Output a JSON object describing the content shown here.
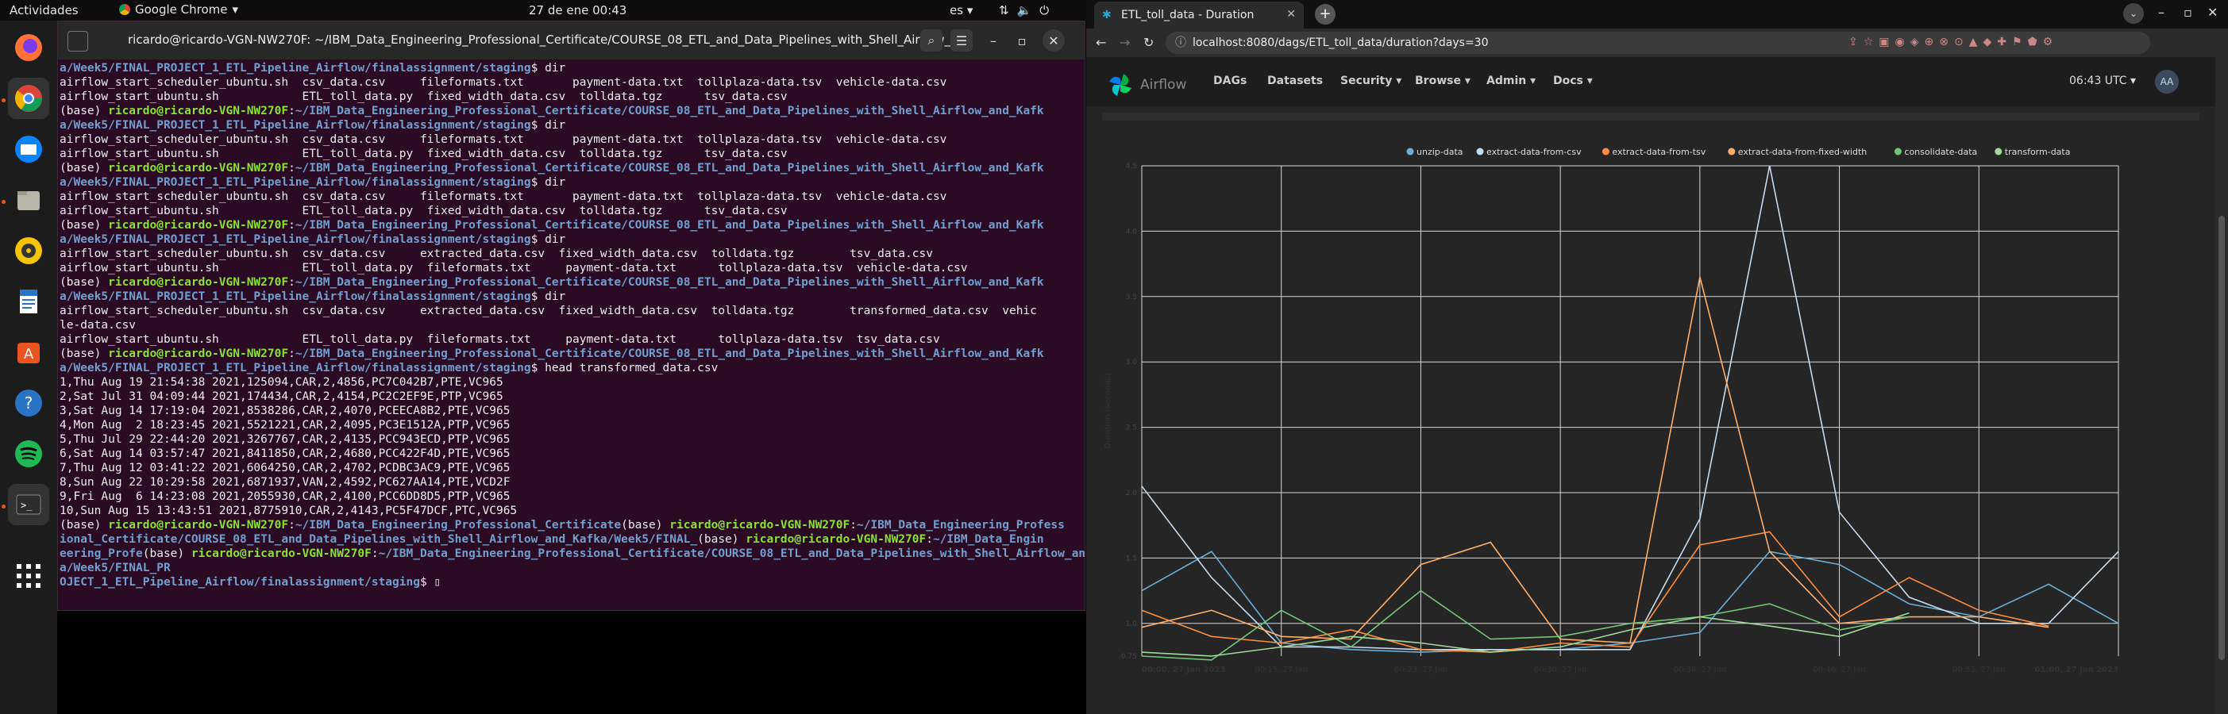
{
  "topbar": {
    "activities": "Actividades",
    "app_name": "Google Chrome",
    "clock": "27 de ene  00:43",
    "lang": "es"
  },
  "terminal": {
    "title": "ricardo@ricardo-VGN-NW270F: ~/IBM_Data_Engineering_Professional_Certificate/COURSE_08_ETL_and_Data_Pipelines_with_Shell_Airflow_...",
    "lines": [
      [
        [
          "t",
          "a/Week5/FINAL_PROJECT_1_ETL_Pipeline_Airflow/finalassignment/staging"
        ],
        [
          "n",
          "$ dir"
        ]
      ],
      [
        [
          "n",
          "airflow_start_scheduler_ubuntu.sh  csv_data.csv     fileformats.txt       payment-data.txt  tollplaza-data.tsv  vehicle-data.csv"
        ]
      ],
      [
        [
          "n",
          "airflow_start_ubuntu.sh            ETL_toll_data.py  fixed_width_data.csv  tolldata.tgz      tsv_data.csv"
        ]
      ],
      [
        [
          "n",
          "(base) "
        ],
        [
          "u",
          "ricardo@ricardo-VGN-NW270F"
        ],
        [
          "n",
          ":"
        ],
        [
          "p",
          "~/IBM_Data_Engineering_Professional_Certificate/COURSE_08_ETL_and_Data_Pipelines_with_Shell_Airflow_and_Kafk"
        ]
      ],
      [
        [
          "p",
          "a/Week5/FINAL_PROJECT_1_ETL_Pipeline_Airflow/finalassignment/staging"
        ],
        [
          "n",
          "$ dir"
        ]
      ],
      [
        [
          "n",
          "airflow_start_scheduler_ubuntu.sh  csv_data.csv     fileformats.txt       payment-data.txt  tollplaza-data.tsv  vehicle-data.csv"
        ]
      ],
      [
        [
          "n",
          "airflow_start_ubuntu.sh            ETL_toll_data.py  fixed_width_data.csv  tolldata.tgz      tsv_data.csv"
        ]
      ],
      [
        [
          "n",
          "(base) "
        ],
        [
          "u",
          "ricardo@ricardo-VGN-NW270F"
        ],
        [
          "n",
          ":"
        ],
        [
          "p",
          "~/IBM_Data_Engineering_Professional_Certificate/COURSE_08_ETL_and_Data_Pipelines_with_Shell_Airflow_and_Kafk"
        ]
      ],
      [
        [
          "p",
          "a/Week5/FINAL_PROJECT_1_ETL_Pipeline_Airflow/finalassignment/staging"
        ],
        [
          "n",
          "$ dir"
        ]
      ],
      [
        [
          "n",
          "airflow_start_scheduler_ubuntu.sh  csv_data.csv     fileformats.txt       payment-data.txt  tollplaza-data.tsv  vehicle-data.csv"
        ]
      ],
      [
        [
          "n",
          "airflow_start_ubuntu.sh            ETL_toll_data.py  fixed_width_data.csv  tolldata.tgz      tsv_data.csv"
        ]
      ],
      [
        [
          "n",
          "(base) "
        ],
        [
          "u",
          "ricardo@ricardo-VGN-NW270F"
        ],
        [
          "n",
          ":"
        ],
        [
          "p",
          "~/IBM_Data_Engineering_Professional_Certificate/COURSE_08_ETL_and_Data_Pipelines_with_Shell_Airflow_and_Kafk"
        ]
      ],
      [
        [
          "p",
          "a/Week5/FINAL_PROJECT_1_ETL_Pipeline_Airflow/finalassignment/staging"
        ],
        [
          "n",
          "$ dir"
        ]
      ],
      [
        [
          "n",
          "airflow_start_scheduler_ubuntu.sh  csv_data.csv     extracted_data.csv  fixed_width_data.csv  tolldata.tgz        tsv_data.csv"
        ]
      ],
      [
        [
          "n",
          "airflow_start_ubuntu.sh            ETL_toll_data.py  fileformats.txt     payment-data.txt      tollplaza-data.tsv  vehicle-data.csv"
        ]
      ],
      [
        [
          "n",
          "(base) "
        ],
        [
          "u",
          "ricardo@ricardo-VGN-NW270F"
        ],
        [
          "n",
          ":"
        ],
        [
          "p",
          "~/IBM_Data_Engineering_Professional_Certificate/COURSE_08_ETL_and_Data_Pipelines_with_Shell_Airflow_and_Kafk"
        ]
      ],
      [
        [
          "p",
          "a/Week5/FINAL_PROJECT_1_ETL_Pipeline_Airflow/finalassignment/staging"
        ],
        [
          "n",
          "$ dir"
        ]
      ],
      [
        [
          "n",
          "airflow_start_scheduler_ubuntu.sh  csv_data.csv     extracted_data.csv  fixed_width_data.csv  tolldata.tgz        transformed_data.csv  vehic"
        ]
      ],
      [
        [
          "n",
          "le-data.csv"
        ]
      ],
      [
        [
          "n",
          "airflow_start_ubuntu.sh            ETL_toll_data.py  fileformats.txt     payment-data.txt      tollplaza-data.tsv  tsv_data.csv"
        ]
      ],
      [
        [
          "n",
          "(base) "
        ],
        [
          "u",
          "ricardo@ricardo-VGN-NW270F"
        ],
        [
          "n",
          ":"
        ],
        [
          "p",
          "~/IBM_Data_Engineering_Professional_Certificate/COURSE_08_ETL_and_Data_Pipelines_with_Shell_Airflow_and_Kafk"
        ]
      ],
      [
        [
          "p",
          "a/Week5/FINAL_PROJECT_1_ETL_Pipeline_Airflow/finalassignment/staging"
        ],
        [
          "n",
          "$ head transformed_data.csv"
        ]
      ],
      [
        [
          "n",
          "1,Thu Aug 19 21:54:38 2021,125094,CAR,2,4856,PC7C042B7,PTE,VC965"
        ]
      ],
      [
        [
          "n",
          "2,Sat Jul 31 04:09:44 2021,174434,CAR,2,4154,PC2C2EF9E,PTP,VC965"
        ]
      ],
      [
        [
          "n",
          "3,Sat Aug 14 17:19:04 2021,8538286,CAR,2,4070,PCEECA8B2,PTE,VC965"
        ]
      ],
      [
        [
          "n",
          "4,Mon Aug  2 18:23:45 2021,5521221,CAR,2,4095,PC3E1512A,PTP,VC965"
        ]
      ],
      [
        [
          "n",
          "5,Thu Jul 29 22:44:20 2021,3267767,CAR,2,4135,PCC943ECD,PTP,VC965"
        ]
      ],
      [
        [
          "n",
          "6,Sat Aug 14 03:57:47 2021,8411850,CAR,2,4680,PCC422F4D,PTE,VC965"
        ]
      ],
      [
        [
          "n",
          "7,Thu Aug 12 03:41:22 2021,6064250,CAR,2,4702,PCDBC3AC9,PTE,VC965"
        ]
      ],
      [
        [
          "n",
          "8,Sun Aug 22 10:29:58 2021,6871937,VAN,2,4592,PC627AA14,PTE,VCD2F"
        ]
      ],
      [
        [
          "n",
          "9,Fri Aug  6 14:23:08 2021,2055930,CAR,2,4100,PCC6DD8D5,PTP,VC965"
        ]
      ],
      [
        [
          "n",
          "10,Sun Aug 15 13:43:51 2021,8775910,CAR,2,4143,PC5F47DCF,PTC,VC965"
        ]
      ],
      [
        [
          "n",
          "(base) "
        ],
        [
          "u",
          "ricardo@ricardo-VGN-NW270F"
        ],
        [
          "n",
          ":"
        ],
        [
          "p",
          "~/IBM_Data_Engineering_Professional_Certificate"
        ],
        [
          "n",
          "(base) "
        ],
        [
          "u",
          "ricardo@ricardo-VGN-NW270F"
        ],
        [
          "n",
          ":"
        ],
        [
          "p",
          "~/IBM_Data_Engineering_Profess"
        ]
      ],
      [
        [
          "p",
          "ional_Certificate/COURSE_08_ETL_and_Data_Pipelines_with_Shell_Airflow_and_Kafka/Week5/FINAL_"
        ],
        [
          "n",
          "(base) "
        ],
        [
          "u",
          "ricardo@ricardo-VGN-NW270F"
        ],
        [
          "n",
          ":"
        ],
        [
          "p",
          "~/IBM_Data_Engin"
        ]
      ],
      [
        [
          "p",
          "eering_Profe"
        ],
        [
          "n",
          "(base) "
        ],
        [
          "u",
          "ricardo@ricardo-VGN-NW270F"
        ],
        [
          "n",
          ":"
        ],
        [
          "p",
          "~/IBM_Data_Engineering_Professional_Certificate/COURSE_08_ETL_and_Data_Pipelines_with_Shell_Airflow_and_Kafk"
        ]
      ],
      [
        [
          "p",
          "a/Week5/FINAL_PR"
        ]
      ],
      [
        [
          "p",
          "OJECT_1_ETL_Pipeline_Airflow/finalassignment/staging"
        ],
        [
          "n",
          "$ ▯"
        ]
      ]
    ]
  },
  "browser": {
    "tab_title": "ETL_toll_data - Duration",
    "url": "localhost:8080/dags/ETL_toll_data/duration?days=30",
    "nav": {
      "brand": "Airflow",
      "items": [
        "DAGs",
        "Datasets",
        "Security ▾",
        "Browse ▾",
        "Admin ▾",
        "Docs ▾"
      ],
      "time": "06:43 UTC ▾",
      "avatar": "AA"
    }
  },
  "chart_data": {
    "type": "line",
    "ylabel": "Duration (seconds)",
    "ylim": [
      0.75,
      4.5
    ],
    "yticks": [
      1.0,
      1.5,
      2.0,
      2.5,
      3.0,
      3.5,
      4.0,
      4.5
    ],
    "ytick_labels": [
      "1.0",
      "1.5",
      "2.0",
      "2.5",
      "3.0",
      "3.5",
      "4.0",
      "4.5"
    ],
    "ybottom_label": "0.75",
    "xticks": [
      "00:00, 27 Jan 2023",
      "00:15, 27 Jan",
      "00:23, 27 Jan",
      "00:30, 27 Jan",
      "00:38, 27 Jan",
      "00:46, 27 Jan",
      "00:53, 27 Jan",
      "01:00, 27 Jan 2023"
    ],
    "legend_position": "top",
    "grid": true,
    "series": [
      {
        "name": "unzip-data",
        "color": "#6baed6",
        "values": [
          1.25,
          1.55,
          0.85,
          0.8,
          0.78,
          0.8,
          0.8,
          0.85,
          0.93,
          1.55,
          1.45,
          1.15,
          1.05,
          1.3,
          1.0
        ]
      },
      {
        "name": "extract-data-from-csv",
        "color": "#c6dbef",
        "values": [
          2.05,
          1.35,
          0.82,
          0.82,
          0.8,
          0.8,
          0.8,
          0.8,
          1.8,
          4.5,
          1.85,
          1.2,
          1.0,
          1.0,
          1.55
        ]
      },
      {
        "name": "extract-data-from-tsv",
        "color": "#fd8d3c",
        "values": [
          1.1,
          0.9,
          0.85,
          0.95,
          0.8,
          0.78,
          0.85,
          0.82,
          1.6,
          1.7,
          1.05,
          1.35,
          1.1,
          0.98,
          null
        ]
      },
      {
        "name": "extract-data-from-fixed-width",
        "color": "#fdae6b",
        "values": [
          0.97,
          1.1,
          0.9,
          0.88,
          1.45,
          1.62,
          0.88,
          0.85,
          3.65,
          1.55,
          1.0,
          1.05,
          1.05,
          0.97,
          null
        ]
      },
      {
        "name": "consolidate-data",
        "color": "#74c476",
        "values": [
          0.75,
          0.72,
          1.1,
          0.82,
          1.25,
          0.88,
          0.9,
          1.0,
          1.05,
          1.15,
          0.95,
          1.05,
          null,
          null,
          null
        ]
      },
      {
        "name": "transform-data",
        "color": "#a1d99b",
        "values": [
          0.78,
          0.75,
          0.82,
          0.9,
          0.85,
          0.78,
          0.82,
          0.95,
          1.05,
          0.98,
          0.9,
          1.08,
          null,
          null,
          null
        ]
      }
    ]
  }
}
